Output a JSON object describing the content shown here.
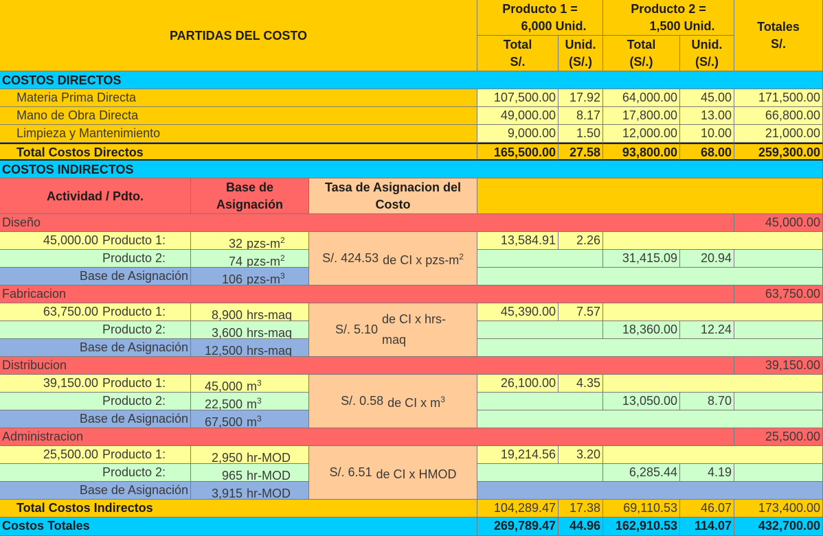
{
  "header": {
    "partidas": "PARTIDAS DEL COSTO",
    "producto1_line1": "Producto 1 =",
    "producto1_line2": "6,000  Unid.",
    "producto2_line1": "Producto 2 =",
    "producto2_line2": "1,500  Unid.",
    "totales_line1": "Totales",
    "totales_line2": "S/.",
    "total_a": "Total",
    "total_a2": "S/.",
    "unid_a": "Unid.",
    "unid_a2": "(S/.)",
    "total_b": "Total",
    "total_b2": "(S/.)",
    "unid_b": "Unid.",
    "unid_b2": "(S/.)"
  },
  "directos": {
    "title": "COSTOS DIRECTOS",
    "rows": [
      {
        "label": "Materia Prima Directa",
        "p1_total": "107,500.00",
        "p1_unid": "17.92",
        "p2_total": "64,000.00",
        "p2_unid": "45.00",
        "total": "171,500.00"
      },
      {
        "label": "Mano de Obra Directa",
        "p1_total": "49,000.00",
        "p1_unid": "8.17",
        "p2_total": "17,800.00",
        "p2_unid": "13.00",
        "total": "66,800.00"
      },
      {
        "label": "Limpieza y Mantenimiento",
        "p1_total": "9,000.00",
        "p1_unid": "1.50",
        "p2_total": "12,000.00",
        "p2_unid": "10.00",
        "total": "21,000.00"
      }
    ],
    "total_row": {
      "label": "Total Costos Directos",
      "p1_total": "165,500.00",
      "p1_unid": "27.58",
      "p2_total": "93,800.00",
      "p2_unid": "68.00",
      "total": "259,300.00"
    }
  },
  "indirectos": {
    "title": "COSTOS INDIRECTOS",
    "col_actividad": "Actividad / Pdto.",
    "col_base_1": "Base de",
    "col_base_2": "Asignación",
    "col_tasa_1": "Tasa de Asignacion del",
    "col_tasa_2": "Costo",
    "activities": [
      {
        "name": "Diseño",
        "total": "45,000.00",
        "amount": "45,000.00",
        "p1_label": "Producto 1:",
        "p1_qty": "32",
        "p2_label": "Producto 2:",
        "p2_qty": "74",
        "base_label": "Base de Asignación",
        "base_qty": "106",
        "unit_main": "pzs-m",
        "unit_sup_p": "2",
        "unit_sup_base": "3",
        "rate": "S/. 424.53",
        "rate_unit": "de CI x pzs-m",
        "rate_sup": "2",
        "p1_total": "13,584.91",
        "p1_unid": "2.26",
        "p2_total": "31,415.09",
        "p2_unid": "20.94"
      },
      {
        "name": "Fabricacion",
        "total": "63,750.00",
        "amount": "63,750.00",
        "p1_label": "Producto 1:",
        "p1_qty": "8,900",
        "p2_label": "Producto 2:",
        "p2_qty": "3,600",
        "base_label": "Base de Asignación",
        "base_qty": "12,500",
        "unit_main": "hrs-maq",
        "unit_sup_p": "",
        "unit_sup_base": "",
        "rate": "S/. 5.10",
        "rate_unit": "de CI x hrs-maq",
        "rate_sup": "",
        "p1_total": "45,390.00",
        "p1_unid": "7.57",
        "p2_total": "18,360.00",
        "p2_unid": "12.24"
      },
      {
        "name": "Distribucion",
        "total": "39,150.00",
        "amount": "39,150.00",
        "p1_label": "Producto 1:",
        "p1_qty": "45,000",
        "p2_label": "Producto 2:",
        "p2_qty": "22,500",
        "base_label": "Base de Asignación",
        "base_qty": "67,500",
        "unit_main": "m",
        "unit_sup_p": "3",
        "unit_sup_base": "3",
        "rate": "S/. 0.58",
        "rate_unit": "de CI x m",
        "rate_sup": "3",
        "p1_total": "26,100.00",
        "p1_unid": "4.35",
        "p2_total": "13,050.00",
        "p2_unid": "8.70"
      },
      {
        "name": "Administracion",
        "total": "25,500.00",
        "amount": "25,500.00",
        "p1_label": "Producto 1:",
        "p1_qty": "2,950",
        "p2_label": "Producto 2:",
        "p2_qty": "965",
        "base_label": "Base de Asignación",
        "base_qty": "3,915",
        "unit_main": "hr-MOD",
        "unit_sup_p": "",
        "unit_sup_base": "",
        "rate": "S/. 6.51",
        "rate_unit": "de CI x HMOD",
        "rate_sup": "",
        "p1_total": "19,214.56",
        "p1_unid": "3.20",
        "p2_total": "6,285.44",
        "p2_unid": "4.19"
      }
    ],
    "total_row": {
      "label": "Total Costos Indirectos",
      "p1_total": "104,289.47",
      "p1_unid": "17.38",
      "p2_total": "69,110.53",
      "p2_unid": "46.07",
      "total": "173,400.00"
    }
  },
  "costos_totales": {
    "label": "Costos Totales",
    "p1_total": "269,789.47",
    "p1_unid": "44.96",
    "p2_total": "162,910.53",
    "p2_unid": "114.07",
    "total": "432,700.00"
  }
}
